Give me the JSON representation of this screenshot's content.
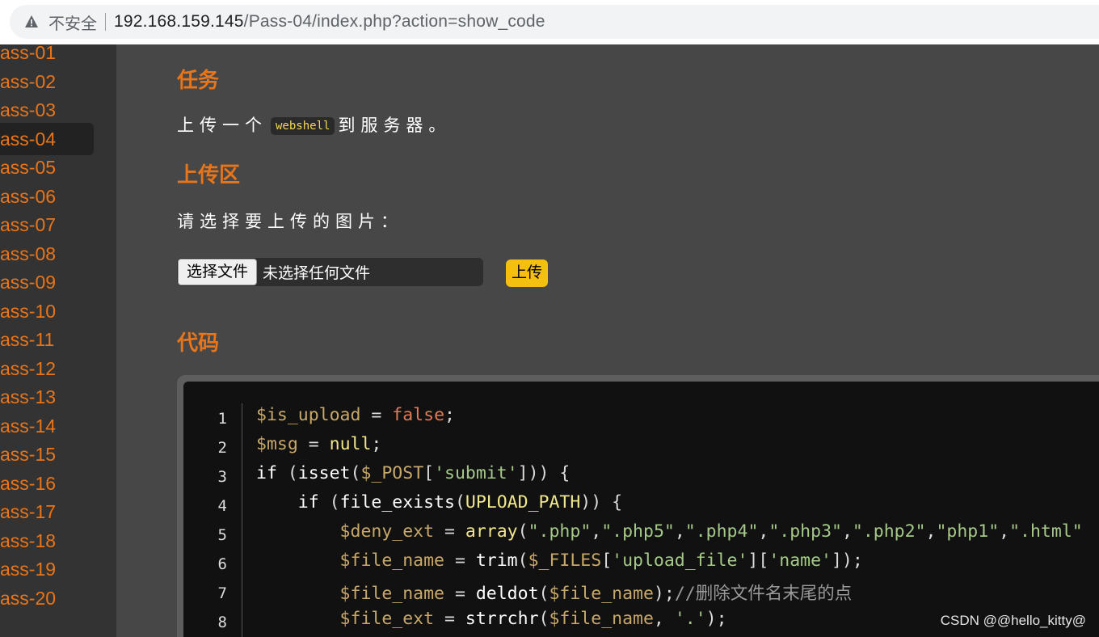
{
  "browser": {
    "security_label": "不安全",
    "url_host": "192.168.159.145",
    "url_path": "/Pass-04/index.php?action=show_code"
  },
  "sidebar": {
    "items": [
      "ass-01",
      "ass-02",
      "ass-03",
      "ass-04",
      "ass-05",
      "ass-06",
      "ass-07",
      "ass-08",
      "ass-09",
      "ass-10",
      "ass-11",
      "ass-12",
      "ass-13",
      "ass-14",
      "ass-15",
      "ass-16",
      "ass-17",
      "ass-18",
      "ass-19",
      "ass-20"
    ],
    "active_index": 3
  },
  "task": {
    "heading": "任务",
    "text_before": "上传一个",
    "inline_code": "webshell",
    "text_after": "到服务器。"
  },
  "upload": {
    "heading": "上传区",
    "prompt": "请选择要上传的图片：",
    "choose_button": "选择文件",
    "file_status": "未选择任何文件",
    "submit_button": "上传"
  },
  "code": {
    "heading": "代码",
    "line_numbers": [
      "1",
      "2",
      "3",
      "4",
      "5",
      "6",
      "7",
      "8"
    ],
    "lines": [
      [
        {
          "t": "$is_upload",
          "c": "v"
        },
        {
          "t": " = ",
          "c": ""
        },
        {
          "t": "false",
          "c": "lit"
        },
        {
          "t": ";",
          "c": ""
        }
      ],
      [
        {
          "t": "$msg",
          "c": "v"
        },
        {
          "t": " = ",
          "c": ""
        },
        {
          "t": "null",
          "c": "f"
        },
        {
          "t": ";",
          "c": ""
        }
      ],
      [
        {
          "t": "if",
          "c": "kw"
        },
        {
          "t": " (",
          "c": ""
        },
        {
          "t": "isset",
          "c": "kw"
        },
        {
          "t": "(",
          "c": ""
        },
        {
          "t": "$_POST",
          "c": "v"
        },
        {
          "t": "[",
          "c": ""
        },
        {
          "t": "'submit'",
          "c": "s"
        },
        {
          "t": "])) {",
          "c": ""
        }
      ],
      [
        {
          "t": "    if",
          "c": "kw"
        },
        {
          "t": " (",
          "c": ""
        },
        {
          "t": "file_exists",
          "c": "kw"
        },
        {
          "t": "(",
          "c": ""
        },
        {
          "t": "UPLOAD_PATH",
          "c": "f"
        },
        {
          "t": ")) {",
          "c": ""
        }
      ],
      [
        {
          "t": "        $deny_ext",
          "c": "v"
        },
        {
          "t": " = ",
          "c": ""
        },
        {
          "t": "array",
          "c": "f"
        },
        {
          "t": "(",
          "c": ""
        },
        {
          "t": "\".php\"",
          "c": "s"
        },
        {
          "t": ",",
          "c": ""
        },
        {
          "t": "\".php5\"",
          "c": "s"
        },
        {
          "t": ",",
          "c": ""
        },
        {
          "t": "\".php4\"",
          "c": "s"
        },
        {
          "t": ",",
          "c": ""
        },
        {
          "t": "\".php3\"",
          "c": "s"
        },
        {
          "t": ",",
          "c": ""
        },
        {
          "t": "\".php2\"",
          "c": "s"
        },
        {
          "t": ",",
          "c": ""
        },
        {
          "t": "\"php1\"",
          "c": "s"
        },
        {
          "t": ",",
          "c": ""
        },
        {
          "t": "\".html\"",
          "c": "s"
        }
      ],
      [
        {
          "t": "        $file_name",
          "c": "v"
        },
        {
          "t": " = ",
          "c": ""
        },
        {
          "t": "trim",
          "c": "kw"
        },
        {
          "t": "(",
          "c": ""
        },
        {
          "t": "$_FILES",
          "c": "v"
        },
        {
          "t": "[",
          "c": ""
        },
        {
          "t": "'upload_file'",
          "c": "s"
        },
        {
          "t": "][",
          "c": ""
        },
        {
          "t": "'name'",
          "c": "s"
        },
        {
          "t": "]);",
          "c": ""
        }
      ],
      [
        {
          "t": "        $file_name",
          "c": "v"
        },
        {
          "t": " = ",
          "c": ""
        },
        {
          "t": "deldot",
          "c": "kw"
        },
        {
          "t": "(",
          "c": ""
        },
        {
          "t": "$file_name",
          "c": "v"
        },
        {
          "t": ");",
          "c": ""
        },
        {
          "t": "//删除文件名末尾的点",
          "c": "cm"
        }
      ],
      [
        {
          "t": "        $file_ext",
          "c": "v"
        },
        {
          "t": " = ",
          "c": ""
        },
        {
          "t": "strrchr",
          "c": "kw"
        },
        {
          "t": "(",
          "c": ""
        },
        {
          "t": "$file_name",
          "c": "v"
        },
        {
          "t": ", ",
          "c": ""
        },
        {
          "t": "'.'",
          "c": "s"
        },
        {
          "t": ");",
          "c": ""
        }
      ]
    ]
  },
  "watermark": "CSDN @@hello_kitty@",
  "colors": {
    "accent_orange": "#e8751a",
    "upload_button": "#f4c010",
    "sidebar_bg": "#333333",
    "main_bg": "#474747",
    "code_bg": "#111111"
  }
}
